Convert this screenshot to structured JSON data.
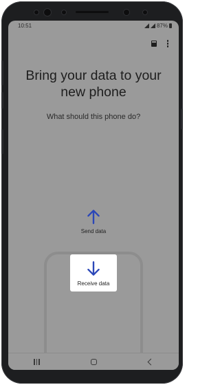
{
  "status_bar": {
    "time": "10:51",
    "battery_text": "87%"
  },
  "app_bar": {
    "icons": [
      "sd-card-icon",
      "more-options-icon"
    ]
  },
  "main": {
    "title": "Bring your data to your new phone",
    "subtitle": "What should this phone do?",
    "send_option": {
      "label": "Send data",
      "icon": "arrow-up-icon"
    },
    "receive_option": {
      "label": "Receive data",
      "icon": "arrow-down-icon"
    }
  },
  "nav_bar": {
    "buttons": [
      "recent-apps",
      "home",
      "back"
    ]
  },
  "colors": {
    "accent": "#2b47b8",
    "screen_overlay": "#9a9a9a",
    "card": "#ffffff"
  }
}
